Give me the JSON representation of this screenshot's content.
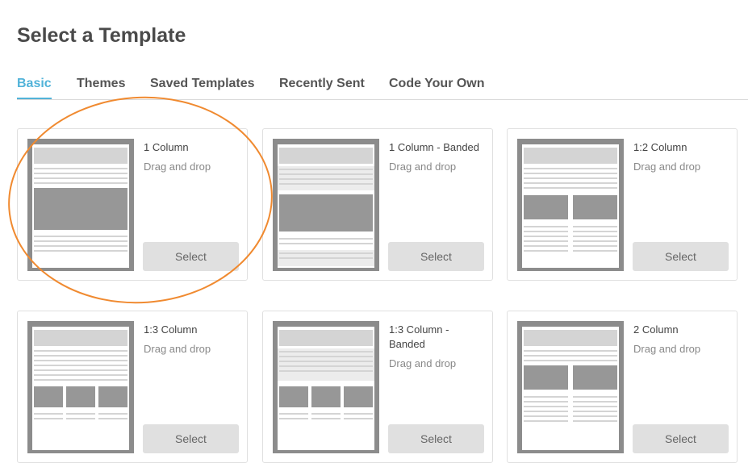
{
  "page": {
    "title": "Select a Template"
  },
  "tabs": [
    {
      "label": "Basic",
      "active": true
    },
    {
      "label": "Themes",
      "active": false
    },
    {
      "label": "Saved Templates",
      "active": false
    },
    {
      "label": "Recently Sent",
      "active": false
    },
    {
      "label": "Code Your Own",
      "active": false
    }
  ],
  "templates": [
    {
      "name": "1 Column",
      "description": "Drag and drop",
      "button": "Select"
    },
    {
      "name": "1 Column - Banded",
      "description": "Drag and drop",
      "button": "Select"
    },
    {
      "name": "1:2 Column",
      "description": "Drag and drop",
      "button": "Select"
    },
    {
      "name": "1:3 Column",
      "description": "Drag and drop",
      "button": "Select"
    },
    {
      "name": "1:3 Column - Banded",
      "description": "Drag and drop",
      "button": "Select"
    },
    {
      "name": "2 Column",
      "description": "Drag and drop",
      "button": "Select"
    }
  ],
  "colors": {
    "active_tab": "#52b3d9",
    "annotation_circle": "#f08a30",
    "thumbnail_frame": "#8c8c8c",
    "select_button": "#e0e0e0"
  }
}
